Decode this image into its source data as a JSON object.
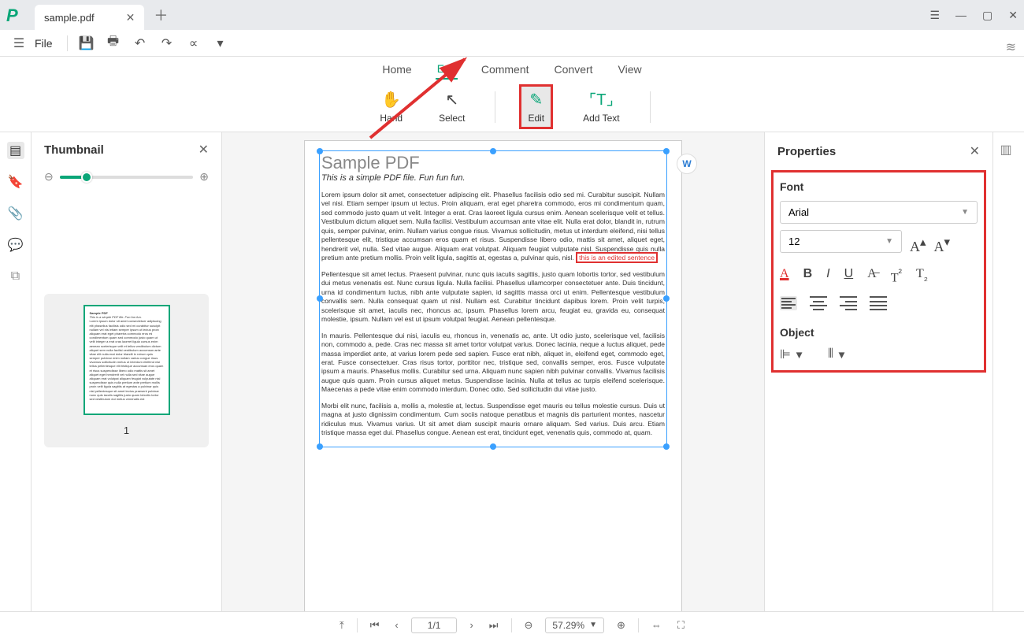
{
  "tab": {
    "title": "sample.pdf"
  },
  "file_menu": "File",
  "menubar": {
    "home": "Home",
    "edit": "Edit",
    "comment": "Comment",
    "convert": "Convert",
    "view": "View"
  },
  "ribbon": {
    "hand": "Hand",
    "select": "Select",
    "edit": "Edit",
    "addtext": "Add Text"
  },
  "thumbnail": {
    "title": "Thumbnail",
    "page_num": "1"
  },
  "properties": {
    "title": "Properties",
    "font_label": "Font",
    "font_name": "Arial",
    "font_size": "12",
    "object_label": "Object"
  },
  "status": {
    "page": "1/1",
    "zoom": "57.29%"
  },
  "doc": {
    "title": "Sample PDF",
    "subtitle": "This is a simple PDF file. Fun fun fun.",
    "p1": "Lorem ipsum dolor sit amet, consectetuer adipiscing elit. Phasellus facilisis odio sed mi. Curabitur suscipit. Nullam vel nisi. Etiam semper ipsum ut lectus. Proin aliquam, erat eget pharetra commodo, eros mi condimentum quam, sed commodo justo quam ut velit. Integer a erat. Cras laoreet ligula cursus enim. Aenean scelerisque velit et tellus. Vestibulum dictum aliquet sem. Nulla facilisi. Vestibulum accumsan ante vitae elit. Nulla erat dolor, blandit in, rutrum quis, semper pulvinar, enim. Nullam varius congue risus. Vivamus sollicitudin, metus ut interdum eleifend, nisi tellus pellentesque elit, tristique accumsan eros quam et risus. Suspendisse libero odio, mattis sit amet, aliquet eget, hendrerit vel, nulla. Sed vitae augue. Aliquam erat volutpat. Aliquam feugiat vulputate nisl. Suspendisse quis nulla pretium ante pretium mollis. Proin velit ligula, sagittis at, egestas a, pulvinar quis, nisl. ",
    "edited": "this is an edited sentence",
    "p2": "Pellentesque sit amet lectus. Praesent pulvinar, nunc quis iaculis sagittis, justo quam lobortis tortor, sed vestibulum dui metus venenatis est. Nunc cursus ligula. Nulla facilisi. Phasellus ullamcorper consectetuer ante. Duis tincidunt, urna id condimentum luctus, nibh ante vulputate sapien, id sagittis massa orci ut enim. Pellentesque vestibulum convallis sem. Nulla consequat quam ut nisl. Nullam est. Curabitur tincidunt dapibus lorem. Proin velit turpis, scelerisque sit amet, iaculis nec, rhoncus ac, ipsum. Phasellus lorem arcu, feugiat eu, gravida eu, consequat molestie, ipsum. Nullam vel est ut ipsum volutpat feugiat. Aenean pellentesque.",
    "p3": "In mauris. Pellentesque dui nisi, iaculis eu, rhoncus in, venenatis ac, ante. Ut odio justo, scelerisque vel, facilisis non, commodo a, pede. Cras nec massa sit amet tortor volutpat varius. Donec lacinia, neque a luctus aliquet, pede massa imperdiet ante, at varius lorem pede sed sapien. Fusce erat nibh, aliquet in, eleifend eget, commodo eget, erat. Fusce consectetuer. Cras risus tortor, porttitor nec, tristique sed, convallis semper, eros. Fusce vulputate ipsum a mauris. Phasellus mollis. Curabitur sed urna. Aliquam nunc sapien nibh pulvinar convallis. Vivamus facilisis augue quis quam. Proin cursus aliquet metus. Suspendisse lacinia. Nulla at tellus ac turpis eleifend scelerisque. Maecenas a pede vitae enim commodo interdum. Donec odio. Sed sollicitudin dui vitae justo.",
    "p4": "Morbi elit nunc, facilisis a, mollis a, molestie at, lectus. Suspendisse eget mauris eu tellus molestie cursus. Duis ut magna at justo dignissim condimentum. Cum sociis natoque penatibus et magnis dis parturient montes, nascetur ridiculus mus. Vivamus varius. Ut sit amet diam suscipit mauris ornare aliquam. Sed varius. Duis arcu. Etiam tristique massa eget dui. Phasellus congue. Aenean est erat, tincidunt eget, venenatis quis, commodo at, quam."
  }
}
